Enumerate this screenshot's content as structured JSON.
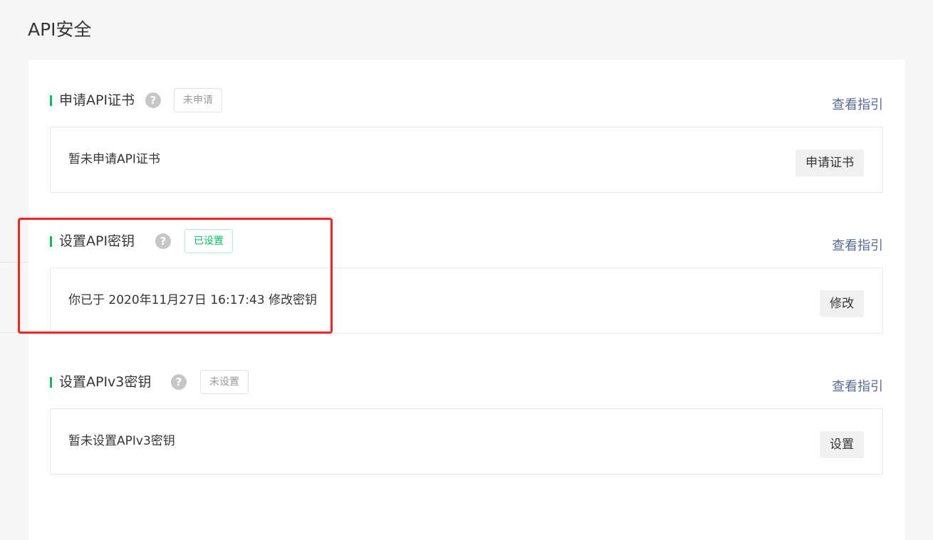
{
  "page": {
    "title": "API安全"
  },
  "sections": [
    {
      "title": "申请API证书",
      "help_icon": "question-circle-icon",
      "status": "未申请",
      "status_state": "inactive",
      "guide_link": "查看指引",
      "description": "暂未申请API证书",
      "action_label": "申请证书"
    },
    {
      "title": "设置API密钥",
      "help_icon": "question-circle-icon",
      "status": "已设置",
      "status_state": "active",
      "guide_link": "查看指引",
      "description": "你已于 2020年11月27日 16:17:43 修改密钥",
      "action_label": "修改"
    },
    {
      "title": "设置APIv3密钥",
      "help_icon": "question-circle-icon",
      "status": "未设置",
      "status_state": "inactive",
      "guide_link": "查看指引",
      "description": "暂未设置APIv3密钥",
      "action_label": "设置"
    }
  ],
  "colors": {
    "accent_green": "#07c160",
    "link_blue": "#576b95",
    "highlight_red": "#f5231f",
    "background": "#f6f6f6"
  }
}
